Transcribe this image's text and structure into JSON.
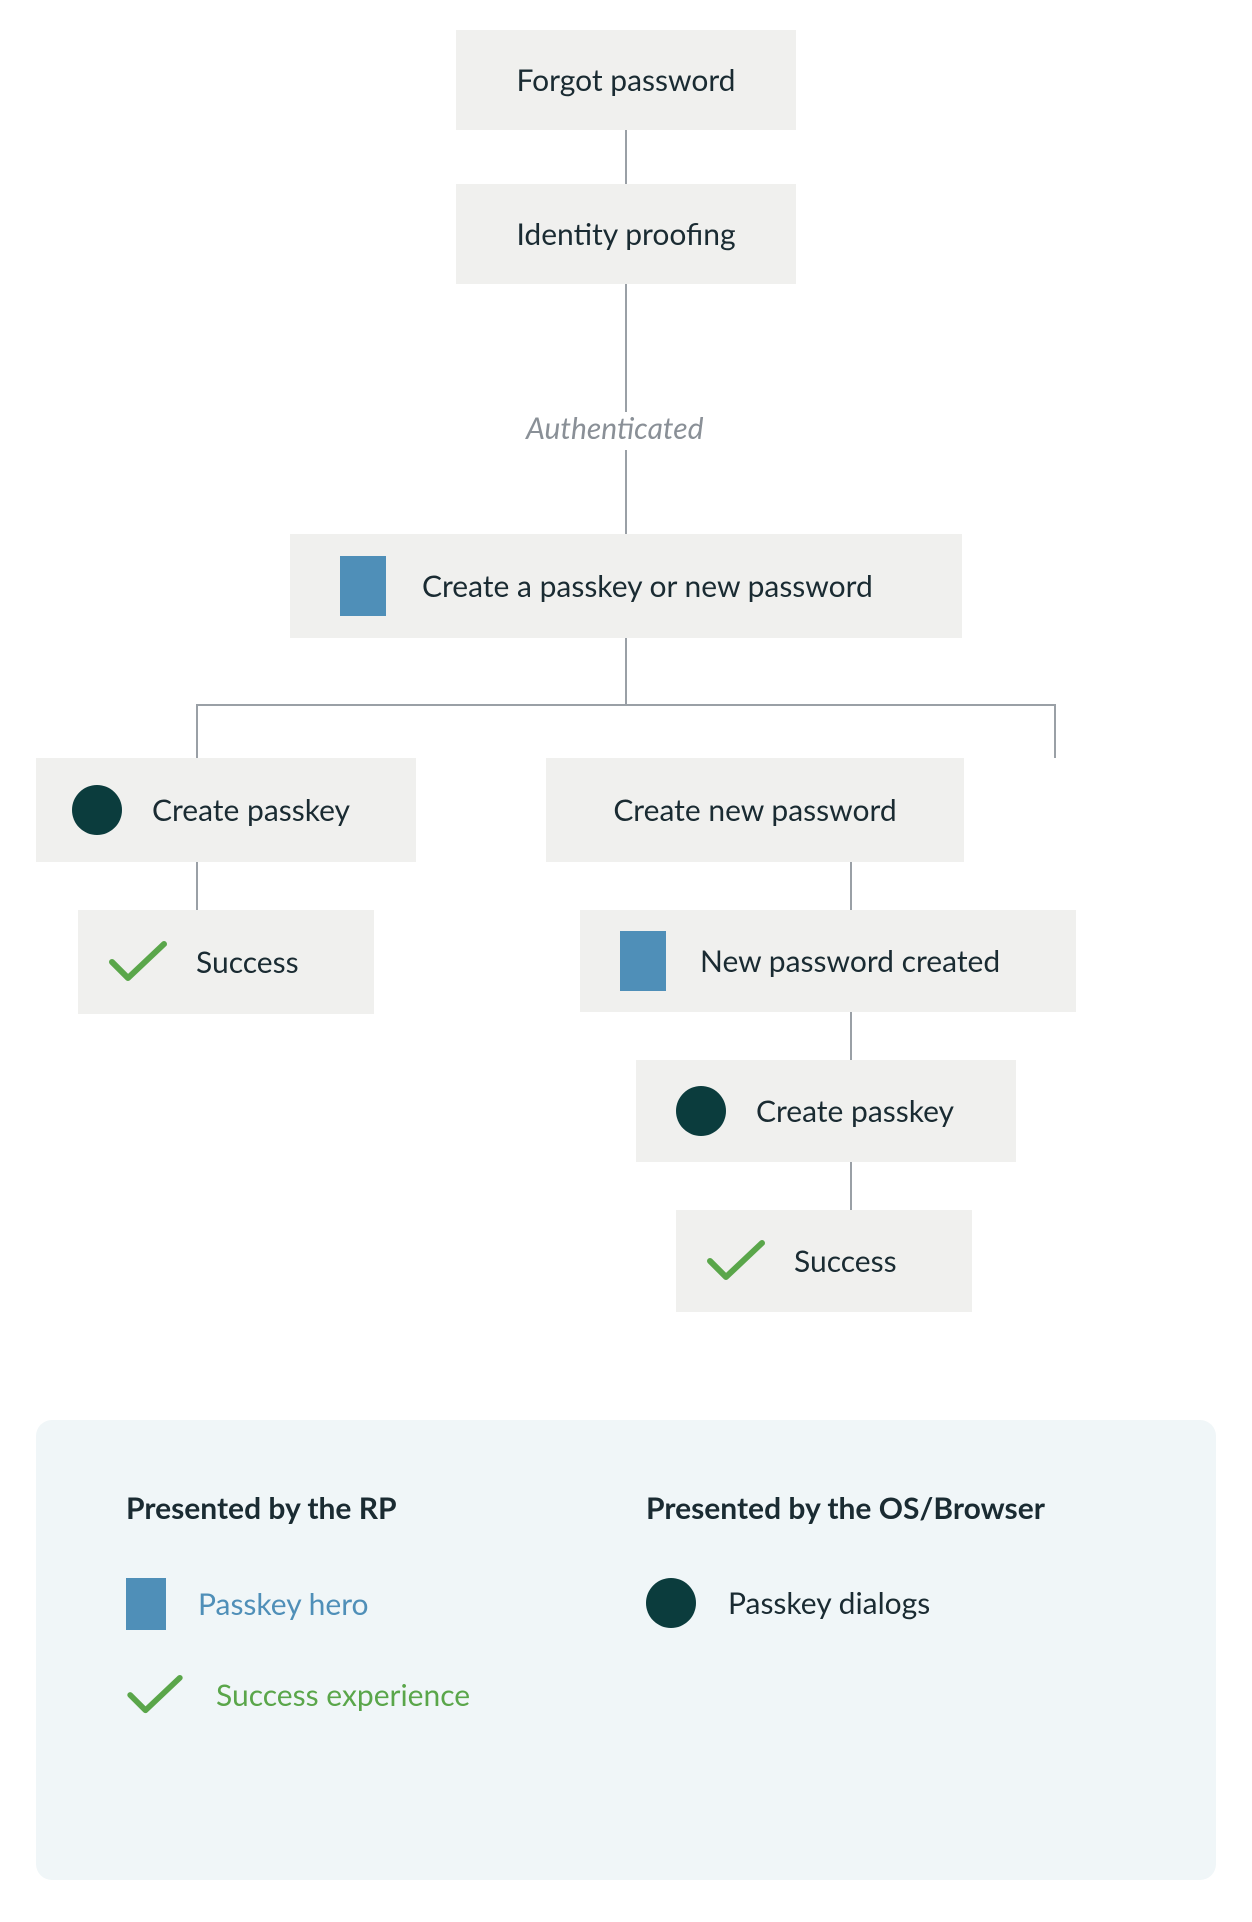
{
  "nodes": {
    "forgot_password": "Forgot password",
    "identity_proofing": "Identity proofing",
    "authenticated": "Authenticated",
    "create_choice": "Create a passkey or new password",
    "create_passkey_left": "Create passkey",
    "success_left": "Success",
    "create_new_password": "Create new password",
    "new_password_created": "New password created",
    "create_passkey_right": "Create passkey",
    "success_right": "Success"
  },
  "legend": {
    "rp_heading": "Presented by the RP",
    "os_heading": "Presented by the OS/Browser",
    "passkey_hero": "Passkey hero",
    "success_experience": "Success experience",
    "passkey_dialogs": "Passkey dialogs"
  },
  "colors": {
    "node_bg": "#f0f0ee",
    "hero_blue": "#4f8fb8",
    "dialog_teal": "#0b3c3d",
    "success_green": "#5aa64a",
    "legend_bg": "#f0f6f8",
    "connector": "#9aa0a6"
  }
}
